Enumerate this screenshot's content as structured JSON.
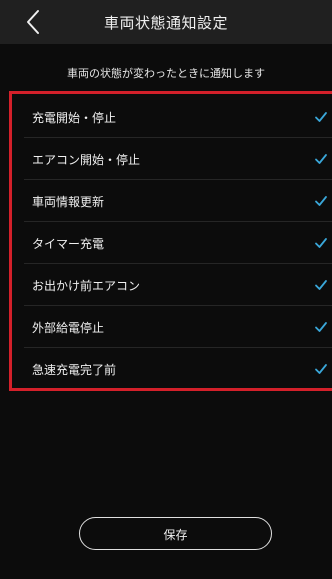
{
  "header": {
    "title": "車両状態通知設定",
    "back_icon": "chevron-left-icon"
  },
  "subtitle": "車両の状態が変わったときに通知します",
  "colors": {
    "background": "#0c0c0c",
    "header_background": "#202020",
    "check_color": "#3aa7d9",
    "highlight_border": "#d4202a"
  },
  "items": [
    {
      "label": "充電開始・停止",
      "checked": true
    },
    {
      "label": "エアコン開始・停止",
      "checked": true
    },
    {
      "label": "車両情報更新",
      "checked": true
    },
    {
      "label": "タイマー充電",
      "checked": true
    },
    {
      "label": "お出かけ前エアコン",
      "checked": true
    },
    {
      "label": "外部給電停止",
      "checked": true
    },
    {
      "label": "急速充電完了前",
      "checked": true
    }
  ],
  "save_button": {
    "label": "保存"
  }
}
